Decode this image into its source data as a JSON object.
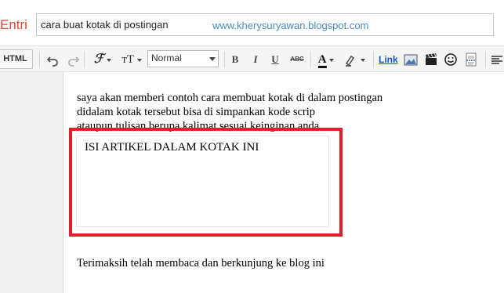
{
  "title_bar": {
    "entri_label": "Entri",
    "title_value": "cara buat kotak di postingan",
    "watermark": "www.kherysuryawan.blogspot.com"
  },
  "toolbar": {
    "html_tab": "HTML",
    "font_size_glyph": "тT",
    "format_select_value": "Normal",
    "bold": "B",
    "italic": "I",
    "underline": "U",
    "strikethrough": "ABC",
    "text_color_glyph": "A",
    "link_label": "Link",
    "icons": [
      "undo-icon",
      "redo-icon",
      "font-family-icon",
      "font-size-icon",
      "bold-icon",
      "italic-icon",
      "underline-icon",
      "strikethrough-icon",
      "text-color-icon",
      "highlight-icon",
      "image-icon",
      "video-icon",
      "emoticon-icon",
      "jump-break-icon",
      "align-icon"
    ]
  },
  "editor": {
    "line1": "saya akan memberi contoh cara membuat kotak di dalam postingan",
    "line2": "didalam kotak tersebut bisa di simpankan kode scrip",
    "line3": "ataupun tulisan berupa kalimat sesuai keinginan anda",
    "box_text": "ISI ARTIKEL DALAM KOTAK INI",
    "closing_line": "Terimaksih telah membaca dan berkunjung ke blog ini"
  },
  "colors": {
    "entri": "#dd4b39",
    "watermark": "#4a8ac0",
    "highlight_border": "#e0202a",
    "link": "#1155cc"
  }
}
